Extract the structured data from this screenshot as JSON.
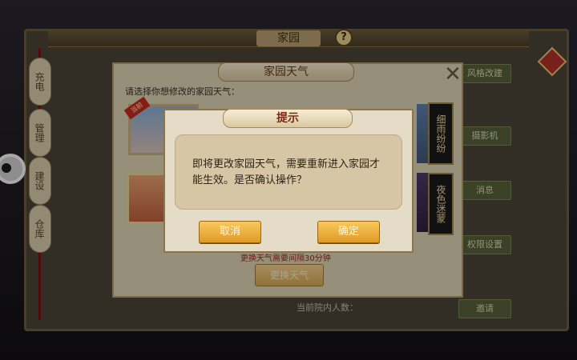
{
  "home": {
    "title": "家园",
    "help": "?",
    "side_tabs": [
      "充电",
      "管理",
      "建设",
      "仓库"
    ],
    "right_buttons": [
      "风格改建",
      "摄影机",
      "消息",
      "权限设置",
      "邀请"
    ],
    "visitor_count_label": "当前院内人数："
  },
  "weather_dialog": {
    "title": "家园天气",
    "close": "✕",
    "prompt": "请选择你想修改的家园天气：",
    "current_badge": "当前",
    "options": [
      "细雨纷纷",
      "夜色迷蒙"
    ],
    "cooldown_text": "更换天气需要间隔30分钟",
    "change_button": "更换天气"
  },
  "confirm_dialog": {
    "title": "提示",
    "message": "即将更改家园天气，需要重新进入家园才能生效。是否确认操作？",
    "cancel_label": "取消",
    "ok_label": "确定"
  },
  "colors": {
    "accent_button": "#f0b040",
    "dialog_bg": "#e4dcc6",
    "title_text": "#7a2a12"
  }
}
